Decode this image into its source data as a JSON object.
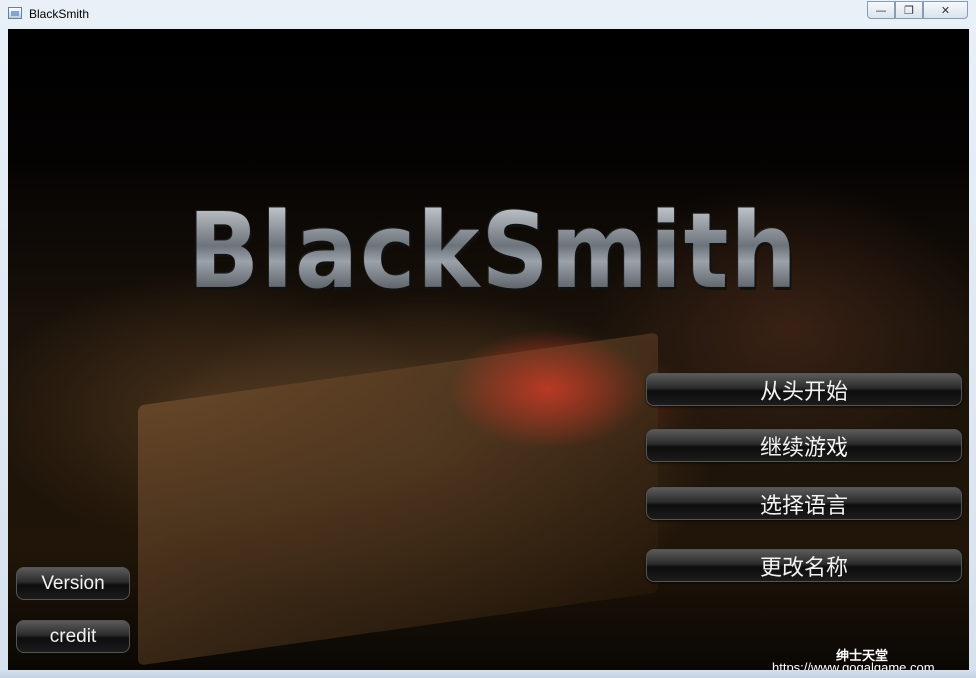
{
  "window": {
    "title": "BlackSmith",
    "buttons": [
      "minimize",
      "restore",
      "close"
    ]
  },
  "game": {
    "logo": "BlackSmith",
    "menu": [
      {
        "label": "从头开始"
      },
      {
        "label": "继续游戏"
      },
      {
        "label": "选择语言"
      },
      {
        "label": "更改名称"
      }
    ],
    "side_buttons": [
      {
        "label": "Version"
      },
      {
        "label": "credit"
      }
    ]
  },
  "watermark": {
    "site_name": "绅士天堂",
    "url": "https://www.gogalgame.com"
  },
  "icons": {
    "app": "app-window-icon",
    "minimize": "minimize-icon",
    "restore": "restore-icon",
    "close": "close-icon"
  }
}
